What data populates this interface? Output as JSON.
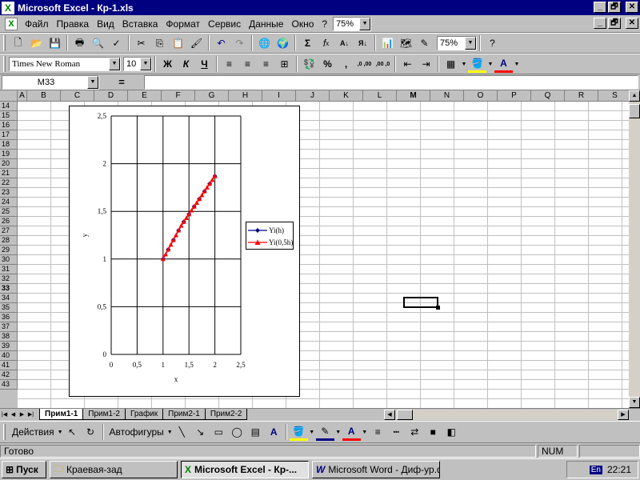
{
  "window": {
    "title": "Microsoft Excel - Кр-1.xls",
    "app_icon": "excel-icon"
  },
  "window_buttons": [
    "_",
    "🗗",
    "✕"
  ],
  "menu": {
    "items": [
      "Файл",
      "Правка",
      "Вид",
      "Вставка",
      "Формат",
      "Сервис",
      "Данные",
      "Окно",
      "?"
    ],
    "zoom": "75%",
    "doc_buttons": [
      "_",
      "🗗",
      "✕"
    ]
  },
  "standard_toolbar": {
    "zoom": "75%"
  },
  "format_toolbar": {
    "font": "Times New Roman",
    "size": "10",
    "bold": "Ж",
    "italic": "К",
    "underline": "Ч",
    "percent": "%",
    "comma": ",",
    "inc_dec": ",0 ,00",
    "dec_dec": ",00 ,0"
  },
  "formula_bar": {
    "name_box": "M33",
    "equals": "=",
    "content": ""
  },
  "columns": [
    "A",
    "B",
    "C",
    "D",
    "E",
    "F",
    "G",
    "H",
    "I",
    "J",
    "K",
    "L",
    "M",
    "N",
    "O",
    "P",
    "Q",
    "R",
    "S"
  ],
  "selected_column": "M",
  "rows": [
    "14",
    "15",
    "16",
    "17",
    "18",
    "19",
    "20",
    "21",
    "22",
    "23",
    "24",
    "25",
    "26",
    "27",
    "28",
    "29",
    "30",
    "31",
    "32",
    "33",
    "34",
    "35",
    "36",
    "37",
    "38",
    "39",
    "40",
    "41",
    "42",
    "43"
  ],
  "selected_row": "33",
  "chart_data": {
    "type": "line",
    "title": "",
    "xlabel": "x",
    "ylabel": "y",
    "xlim": [
      0,
      2.5
    ],
    "ylim": [
      0,
      2.5
    ],
    "xticks": [
      "0",
      "0,5",
      "1",
      "1,5",
      "2",
      "2,5"
    ],
    "yticks": [
      "0",
      "0,5",
      "1",
      "1,5",
      "2",
      "2,5"
    ],
    "grid": true,
    "legend_position": "right",
    "series": [
      {
        "name": "Yi(h)",
        "color": "#000080",
        "marker": "diamond",
        "x": [
          1.0,
          1.1,
          1.2,
          1.3,
          1.4,
          1.5,
          1.6,
          1.7,
          1.8,
          1.9,
          2.0
        ],
        "y": [
          1.0,
          1.1,
          1.2,
          1.3,
          1.39,
          1.47,
          1.55,
          1.63,
          1.71,
          1.79,
          1.87
        ]
      },
      {
        "name": "Yi(0,5h)",
        "color": "#ff0000",
        "marker": "triangle",
        "x": [
          1.0,
          1.05,
          1.1,
          1.15,
          1.2,
          1.25,
          1.3,
          1.35,
          1.4,
          1.45,
          1.5,
          1.55,
          1.6,
          1.65,
          1.7,
          1.75,
          1.8,
          1.85,
          1.9,
          1.95,
          2.0
        ],
        "y": [
          1.0,
          1.05,
          1.1,
          1.15,
          1.2,
          1.25,
          1.3,
          1.35,
          1.39,
          1.43,
          1.47,
          1.51,
          1.55,
          1.59,
          1.63,
          1.67,
          1.71,
          1.75,
          1.79,
          1.83,
          1.87
        ]
      }
    ]
  },
  "sheets": {
    "tabs": [
      "Прим1-1",
      "Прим1-2",
      "График",
      "Прим2-1",
      "Прим2-2"
    ],
    "active": "Прим1-1"
  },
  "drawing_toolbar": {
    "actions": "Действия",
    "autoshapes": "Автофигуры"
  },
  "status": {
    "text": "Готово",
    "num": "NUM"
  },
  "taskbar": {
    "start": "Пуск",
    "items": [
      "Краевая-зад",
      "Microsoft Excel - Кр-...",
      "Microsoft Word - Диф-ур.d..."
    ],
    "active_index": 1,
    "lang": "En",
    "clock": "22:21"
  }
}
